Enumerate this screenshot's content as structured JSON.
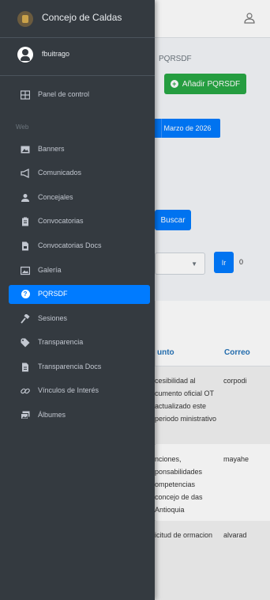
{
  "app": {
    "brand_title": "Concejo de Caldas"
  },
  "user": {
    "username": "fbuitrago"
  },
  "sidebar": {
    "section_web": "Web",
    "items": [
      {
        "label": "Panel de control",
        "icon": "dashboard-icon"
      },
      {
        "label": "Banners",
        "icon": "image-icon"
      },
      {
        "label": "Comunicados",
        "icon": "megaphone-icon"
      },
      {
        "label": "Concejales",
        "icon": "user-icon"
      },
      {
        "label": "Convocatorias",
        "icon": "clipboard-icon"
      },
      {
        "label": "Convocatorias Docs",
        "icon": "file-icon"
      },
      {
        "label": "Galería",
        "icon": "photo-icon"
      },
      {
        "label": "PQRSDF",
        "icon": "question-icon"
      },
      {
        "label": "Sesiones",
        "icon": "gavel-icon"
      },
      {
        "label": "Transparencia",
        "icon": "tag-icon"
      },
      {
        "label": "Transparencia Docs",
        "icon": "document-icon"
      },
      {
        "label": "Vínculos de Interés",
        "icon": "link-icon"
      },
      {
        "label": "Álbumes",
        "icon": "images-icon"
      }
    ],
    "active_item": "PQRSDF",
    "accent_color": "#007bff",
    "background_color": "#343a40"
  },
  "page": {
    "breadcrumb_title": "PQRSDF",
    "add_button_label": "Añadir PQRSDF",
    "month_filter_label": "Marzo de 2026",
    "search_button_label": "Buscar",
    "go_button_label": "Ir",
    "count_text": "0"
  },
  "table": {
    "headers": [
      "unto",
      "Correo"
    ],
    "rows": [
      {
        "asunto": "cesibilidad al cumento oficial OT actualizado este periodo ministrativo",
        "correo": "corpodi"
      },
      {
        "asunto": "nciones, ponsabilidades ompetencias concejo de das Antioquia",
        "correo": "mayahe"
      },
      {
        "asunto": "icitud de ormacion",
        "correo": "alvarad"
      }
    ]
  }
}
